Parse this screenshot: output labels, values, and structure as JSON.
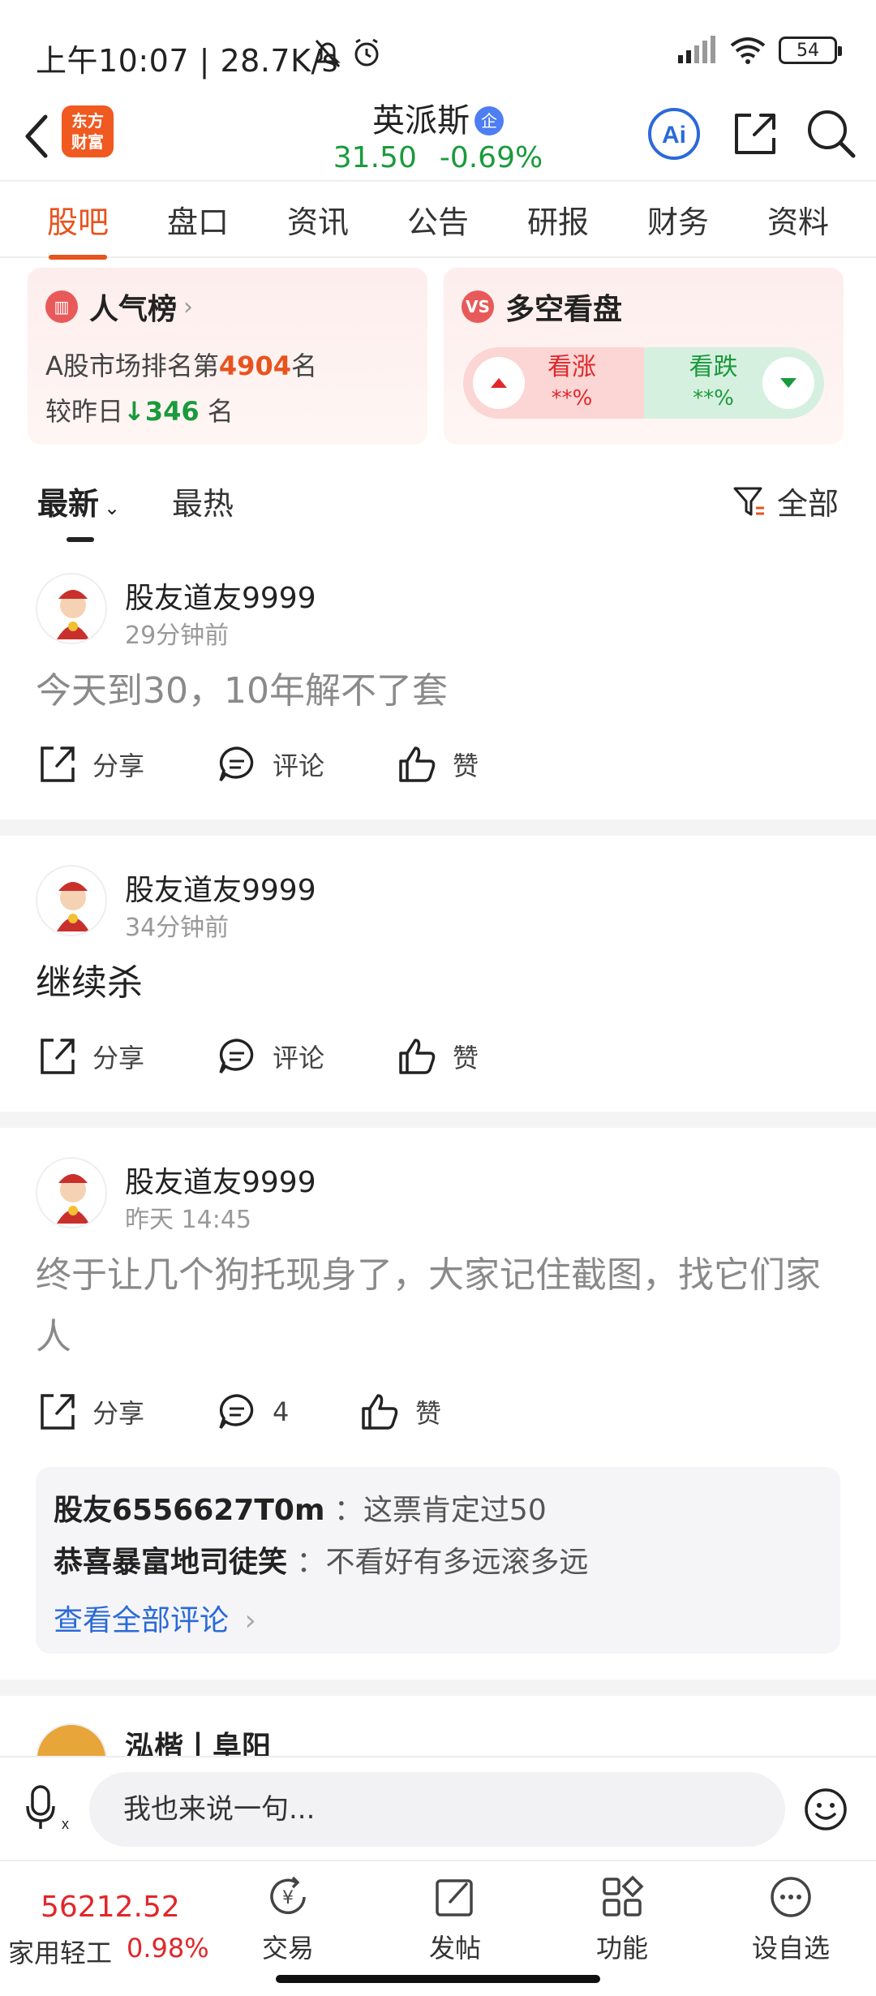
{
  "status_bar": {
    "time_and_speed": "上午10:07 | 28.7K/s",
    "battery": "54"
  },
  "header": {
    "logo_text": "东方\n财富",
    "stock_name": "英派斯",
    "badge": "企",
    "price": "31.50",
    "change": "-0.69%",
    "ai_label": "Ai"
  },
  "tabs": [
    {
      "label": "股吧",
      "active": true
    },
    {
      "label": "盘口"
    },
    {
      "label": "资讯"
    },
    {
      "label": "公告"
    },
    {
      "label": "研报"
    },
    {
      "label": "财务"
    },
    {
      "label": "资料"
    }
  ],
  "popularity_card": {
    "title": "人气榜",
    "rank_prefix": "A股市场排名第",
    "rank": "4904",
    "rank_suffix": "名",
    "change_prefix": "较昨日",
    "change_value": "346",
    "change_suffix": " 名"
  },
  "sentiment_card": {
    "title": "多空看盘",
    "vs_label": "VS",
    "up_label": "看涨",
    "up_pct": "**%",
    "down_label": "看跌",
    "down_pct": "**%"
  },
  "filters": {
    "newest": "最新",
    "hottest": "最热",
    "all": "全部"
  },
  "posts": [
    {
      "user": "股友道友9999",
      "time": "29分钟前",
      "body": "今天到30，10年解不了套",
      "share": "分享",
      "comment": "评论",
      "like": "赞"
    },
    {
      "user": "股友道友9999",
      "time": "34分钟前",
      "body": "继续杀",
      "share": "分享",
      "comment": "评论",
      "like": "赞"
    },
    {
      "user": "股友道友9999",
      "time": "昨天 14:45",
      "body": "终于让几个狗托现身了，大家记住截图，找它们家人",
      "share": "分享",
      "comment": "4",
      "like": "赞",
      "replies": [
        {
          "user": "股友6556627T0m",
          "text": "：这票肯定过50"
        },
        {
          "user": "恭喜暴富地司徒笑",
          "text": "：不看好有多远滚多远"
        }
      ],
      "view_all": "查看全部评论"
    },
    {
      "user": "泓楷丨阜阳"
    }
  ],
  "input_bar": {
    "placeholder": "我也来说一句..."
  },
  "bottom_nav": {
    "index_value": "56212.52",
    "index_name": "家用轻工",
    "index_change": "0.98%",
    "items": [
      {
        "label": "交易"
      },
      {
        "label": "发帖"
      },
      {
        "label": "功能"
      },
      {
        "label": "设自选"
      }
    ]
  }
}
